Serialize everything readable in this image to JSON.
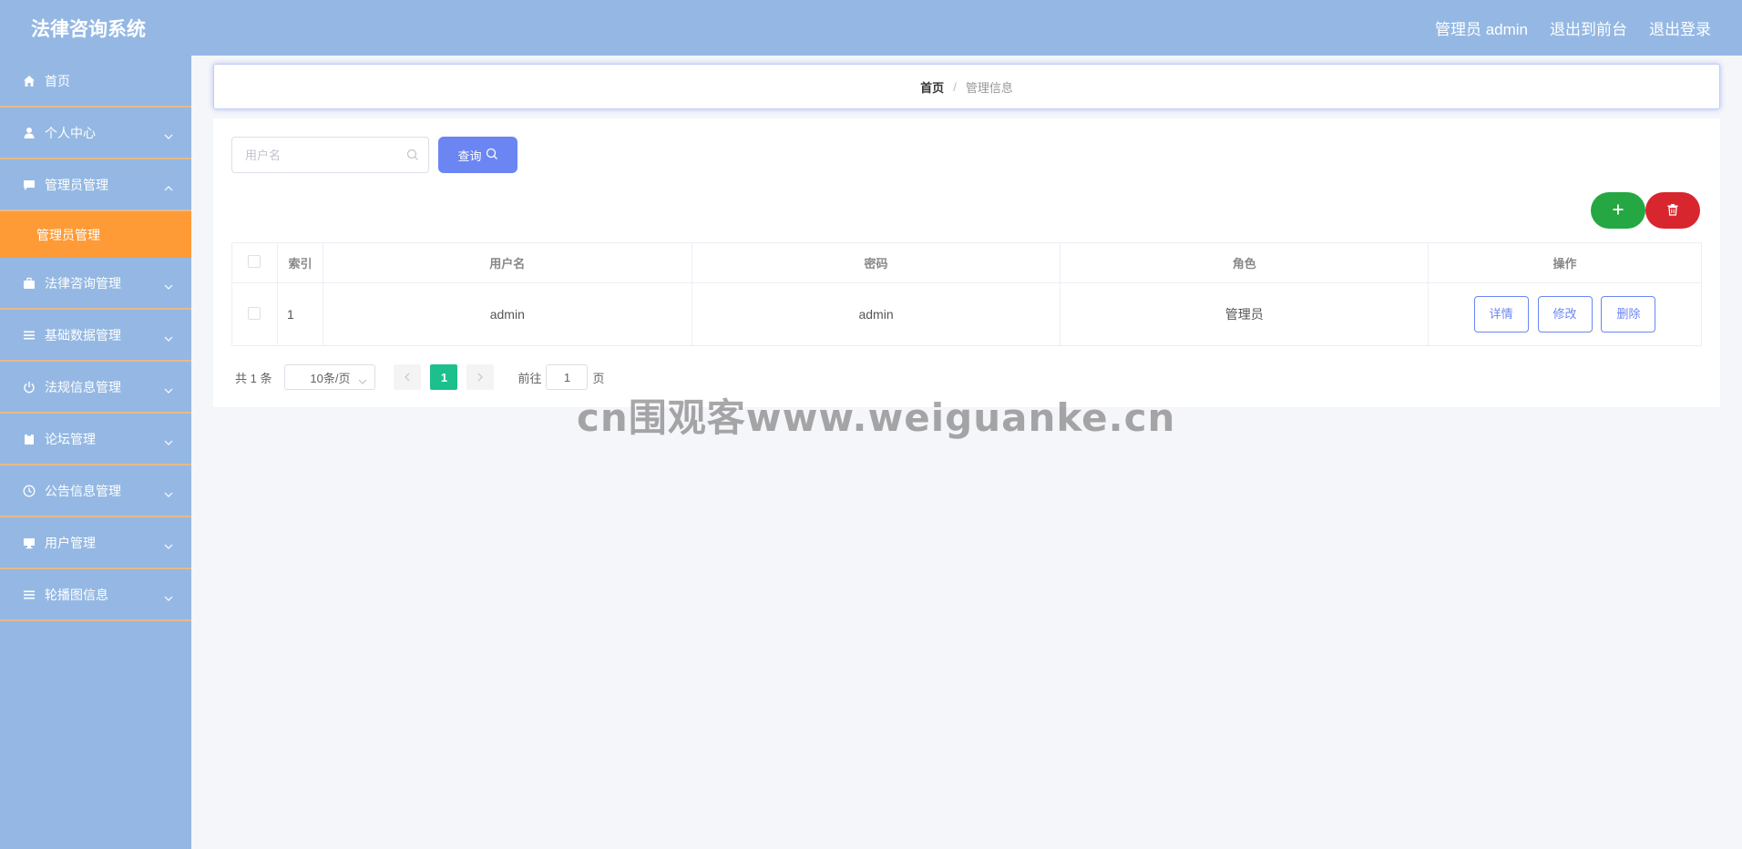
{
  "header": {
    "brand": "法律咨询系统",
    "user_label": "管理员 admin",
    "to_front": "退出到前台",
    "logout": "退出登录"
  },
  "sidebar": {
    "items": [
      {
        "label": "首页",
        "icon": "home-icon"
      },
      {
        "label": "个人中心",
        "icon": "user-icon"
      },
      {
        "label": "管理员管理",
        "icon": "chat-icon"
      },
      {
        "label": "法律咨询管理",
        "icon": "briefcase-icon"
      },
      {
        "label": "基础数据管理",
        "icon": "list-icon"
      },
      {
        "label": "法规信息管理",
        "icon": "power-icon"
      },
      {
        "label": "论坛管理",
        "icon": "clipboard-icon"
      },
      {
        "label": "公告信息管理",
        "icon": "clock-icon"
      },
      {
        "label": "用户管理",
        "icon": "monitor-icon"
      },
      {
        "label": "轮播图信息",
        "icon": "list-icon"
      }
    ],
    "active_sub": "管理员管理"
  },
  "breadcrumb": {
    "home": "首页",
    "current": "管理信息"
  },
  "search": {
    "placeholder": "用户名",
    "button": "查询"
  },
  "table": {
    "headers": [
      "索引",
      "用户名",
      "密码",
      "角色",
      "操作"
    ],
    "rows": [
      {
        "index": "1",
        "username": "admin",
        "password": "admin",
        "role": "管理员"
      }
    ],
    "actions": {
      "detail": "详情",
      "edit": "修改",
      "delete": "删除"
    }
  },
  "pagination": {
    "total": "共 1 条",
    "page_size": "10条/页",
    "current_page": "1",
    "goto_prefix": "前往",
    "goto_value": "1",
    "goto_suffix": "页"
  },
  "watermark": "cn围观客www.weiguanke.cn",
  "colors": {
    "header_bg": "#94b8e3",
    "active_menu": "#ff9b37",
    "primary": "#6b86f2",
    "add": "#25a843",
    "delete": "#d8262f",
    "page_active": "#1cc08d"
  }
}
